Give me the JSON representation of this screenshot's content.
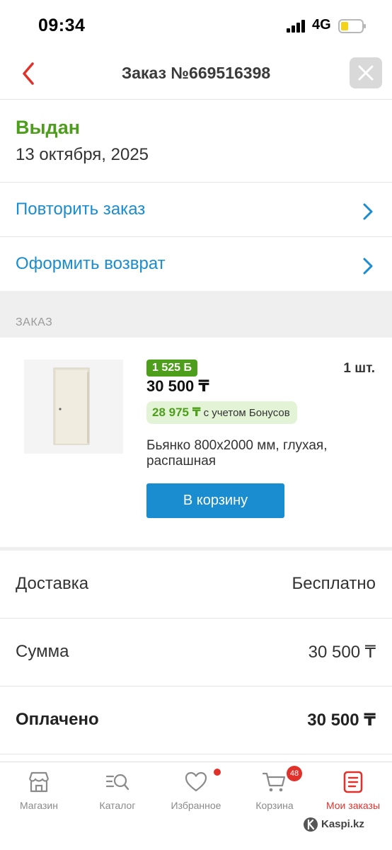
{
  "status_bar": {
    "time": "09:34",
    "network": "4G"
  },
  "header": {
    "title": "Заказ №669516398"
  },
  "order_status": {
    "label": "Выдан",
    "date": "13 октября, 2025"
  },
  "actions": [
    {
      "label": "Повторить заказ"
    },
    {
      "label": "Оформить возврат"
    }
  ],
  "section": {
    "title": "ЗАКАЗ"
  },
  "product": {
    "bonus_badge": "1 525 Б",
    "quantity": "1 шт.",
    "price": "30 500 ₸",
    "bonus_price": "28 975 ₸",
    "bonus_note": "с учетом Бонусов",
    "name": "Бьянко 800x2000 мм, глухая, распашная",
    "cart_button": "В корзину"
  },
  "summary": [
    {
      "label": "Доставка",
      "value": "Бесплатно"
    },
    {
      "label": "Сумма",
      "value": "30 500 ₸"
    },
    {
      "label": "Оплачено",
      "value": "30 500 ₸"
    }
  ],
  "nav": {
    "items": [
      {
        "label": "Магазин",
        "icon": "store-icon"
      },
      {
        "label": "Каталог",
        "icon": "catalog-search-icon"
      },
      {
        "label": "Избранное",
        "icon": "heart-icon"
      },
      {
        "label": "Корзина",
        "icon": "cart-icon"
      },
      {
        "label": "Мои заказы",
        "icon": "orders-icon"
      }
    ],
    "cart_count": "48"
  },
  "watermark": "Kaspi.kz",
  "colors": {
    "accent_red": "#e0322b",
    "link_blue": "#1a8cd0",
    "success_green": "#4d9e1b",
    "bonus_bg": "#e3f4d6"
  }
}
